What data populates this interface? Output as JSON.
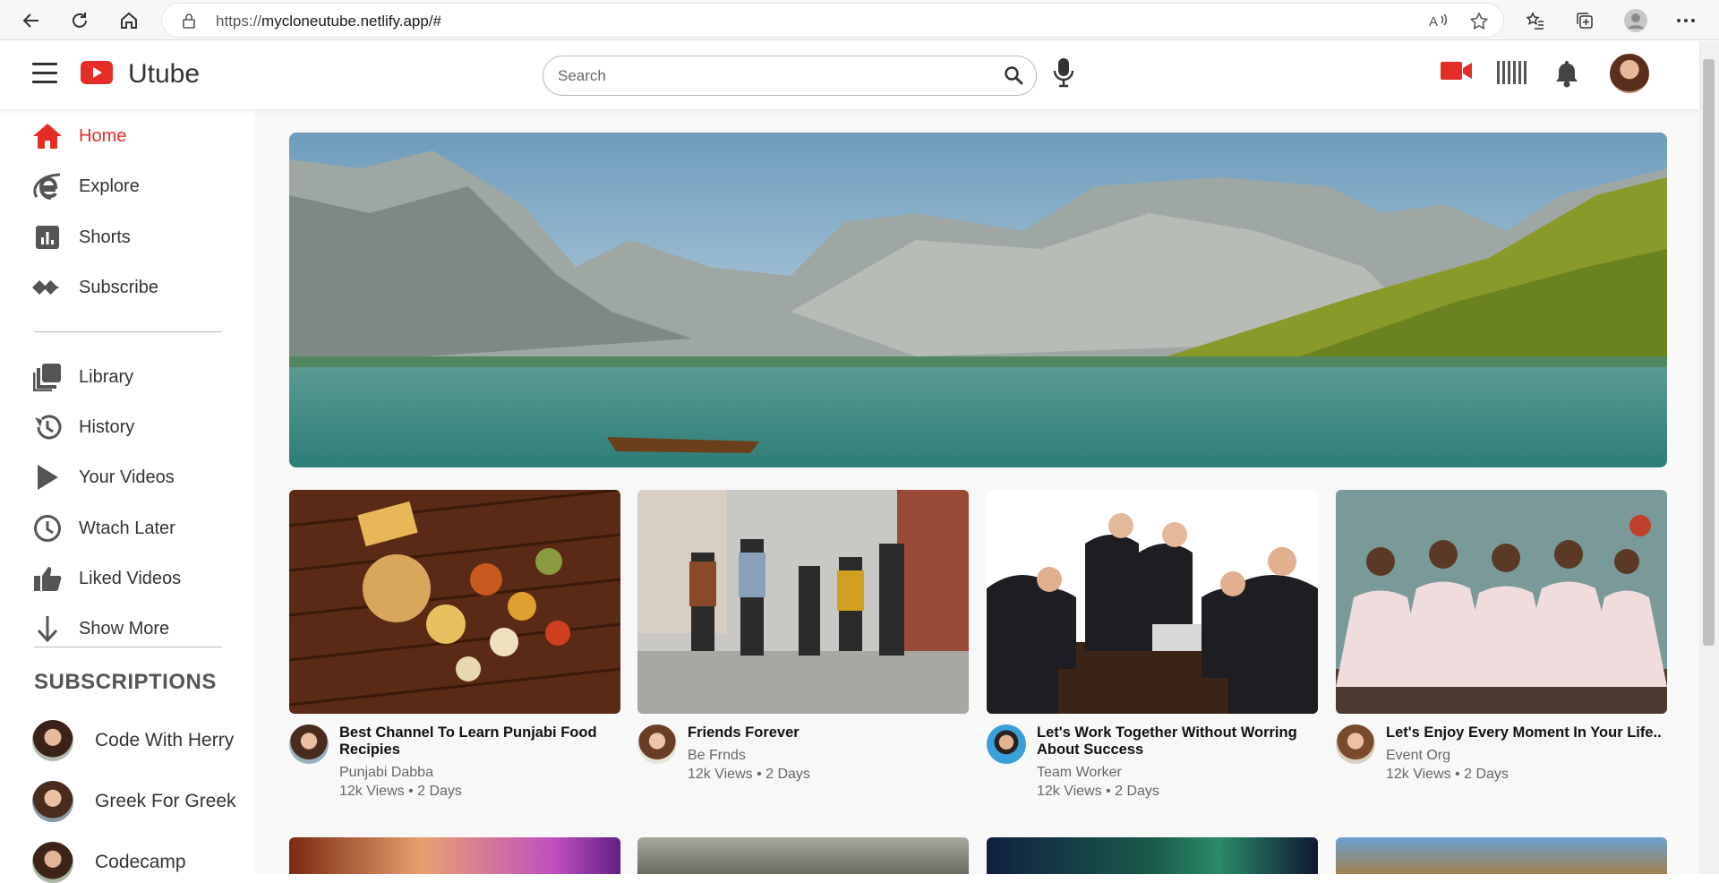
{
  "browser": {
    "url_prefix": "https://",
    "url_host": "mycloneutube.netlify.app/#"
  },
  "header": {
    "logo_text": "Utube",
    "search_placeholder": "Search"
  },
  "sidebar": {
    "items": [
      {
        "label": "Home",
        "icon": "home-icon",
        "active": true
      },
      {
        "label": "Explore",
        "icon": "explore-icon"
      },
      {
        "label": "Shorts",
        "icon": "shorts-icon"
      },
      {
        "label": "Subscribe",
        "icon": "subscribe-icon"
      }
    ],
    "items2": [
      {
        "label": "Library",
        "icon": "library-icon"
      },
      {
        "label": "History",
        "icon": "history-icon"
      },
      {
        "label": "Your Videos",
        "icon": "play-icon"
      },
      {
        "label": "Wtach Later",
        "icon": "clock-icon"
      },
      {
        "label": "Liked Videos",
        "icon": "thumbs-up-icon"
      },
      {
        "label": "Show More",
        "icon": "arrow-down-icon"
      }
    ],
    "subscriptions_title": "SUBSCRIPTIONS",
    "subscriptions": [
      {
        "label": "Code With Herry"
      },
      {
        "label": "Greek For Greek"
      },
      {
        "label": "Codecamp"
      }
    ]
  },
  "videos": [
    {
      "title": "Best Channel To Learn Punjabi Food Recipies",
      "channel": "Punjabi Dabba",
      "stats": "12k Views • 2 Days"
    },
    {
      "title": "Friends Forever",
      "channel": "Be Frnds",
      "stats": "12k Views • 2 Days"
    },
    {
      "title": "Let's Work Together Without Worring About Success",
      "channel": "Team Worker",
      "stats": "12k Views • 2 Days"
    },
    {
      "title": "Let's Enjoy Every Moment In Your Life..",
      "channel": "Event Org",
      "stats": "12k Views • 2 Days"
    }
  ],
  "colors": {
    "accent": "#e52d27"
  }
}
